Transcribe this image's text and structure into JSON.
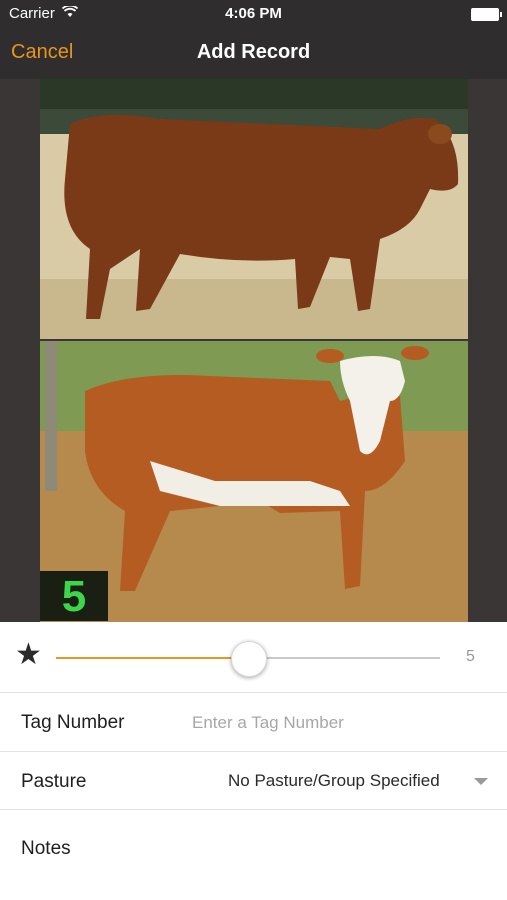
{
  "status": {
    "carrier": "Carrier",
    "time": "4:06 PM"
  },
  "nav": {
    "cancel": "Cancel",
    "title": "Add Record"
  },
  "photo": {
    "badge": "5"
  },
  "rating": {
    "value": 5,
    "value_label": "5",
    "fraction": 0.5,
    "accent": "#e39b1f"
  },
  "fields": {
    "tag_label": "Tag Number",
    "tag_placeholder": "Enter a Tag Number",
    "pasture_label": "Pasture",
    "pasture_value": "No Pasture/Group Specified",
    "notes_label": "Notes"
  }
}
